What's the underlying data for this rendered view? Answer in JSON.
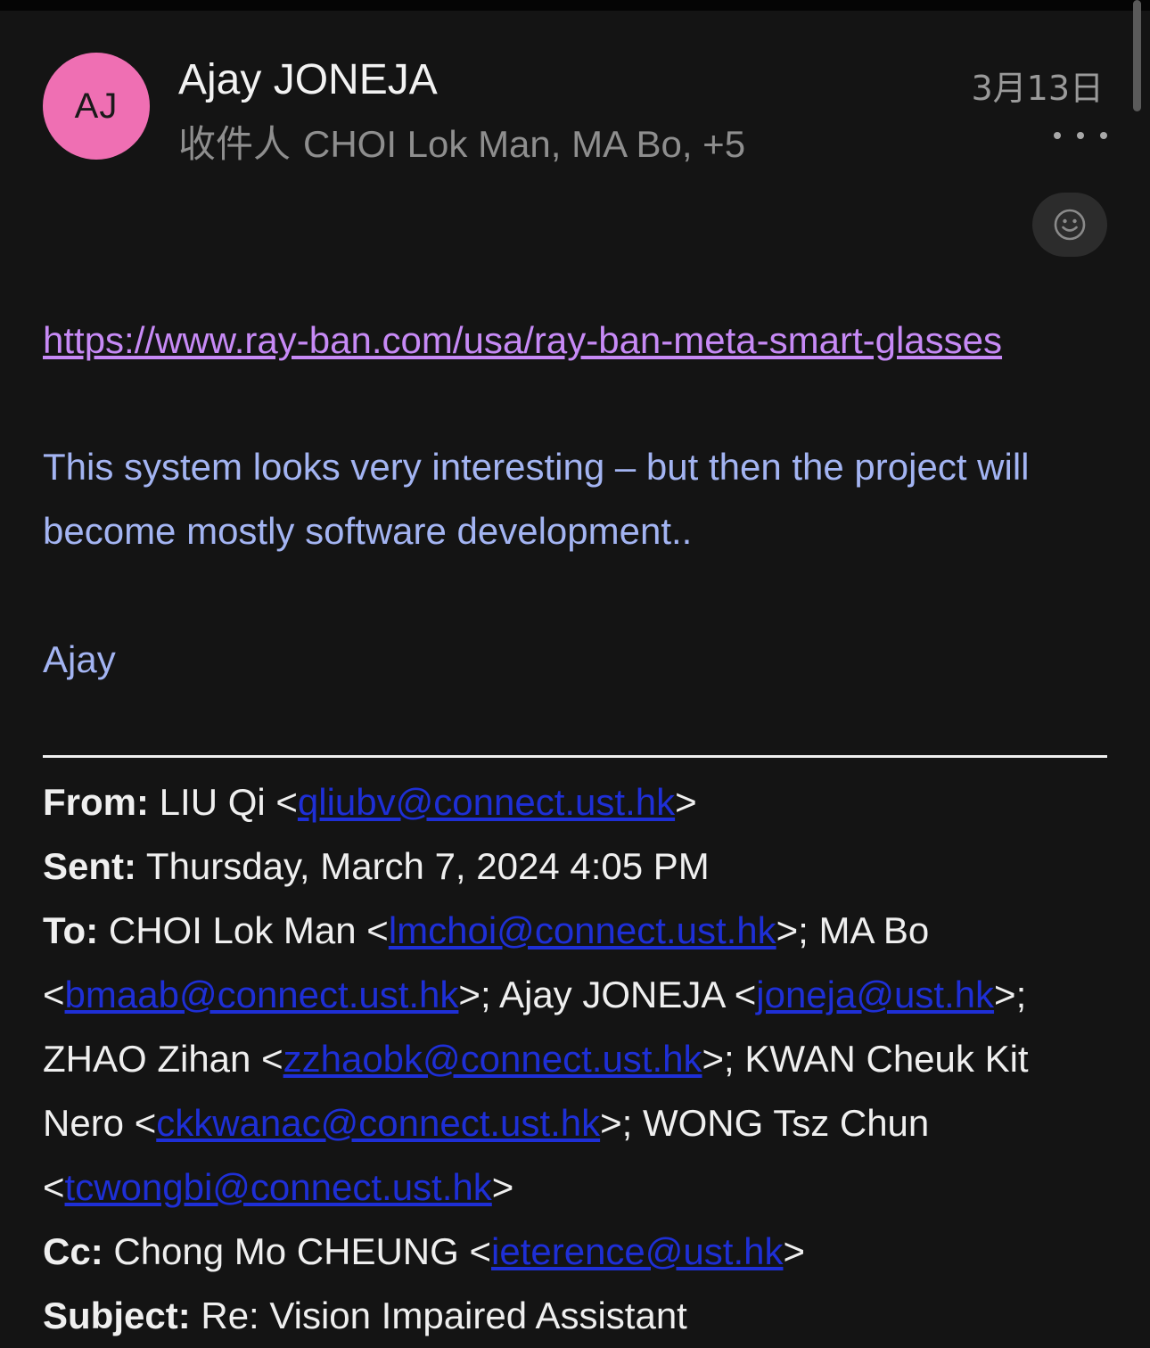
{
  "header": {
    "avatar_initials": "AJ",
    "sender_name": "Ajay JONEJA",
    "to_label": "收件人",
    "recipients_summary": "CHOI Lok Man, MA Bo, +5",
    "date": "3月13日"
  },
  "body": {
    "link_url": "https://www.ray-ban.com/usa/ray-ban-meta-smart-glasses",
    "paragraph": "This system looks very interesting – but then the project will become mostly software development..",
    "signature": "Ajay"
  },
  "quoted": {
    "from": {
      "label": "From:",
      "name": " LIU Qi <",
      "email": "qliubv@connect.ust.hk",
      "tail": ">"
    },
    "sent": {
      "label": "Sent:",
      "value": " Thursday, March 7, 2024 4:05 PM"
    },
    "to": {
      "label": "To:",
      "r1_name": " CHOI Lok Man <",
      "r1_email": "lmchoi@connect.ust.hk",
      "r2_name": ">; MA Bo <",
      "r2_email": "bmaab@connect.ust.hk",
      "r3_name": ">; Ajay JONEJA <",
      "r3_email": "joneja@ust.hk",
      "r4_name": ">; ZHAO Zihan <",
      "r4_email": "zzhaobk@connect.ust.hk",
      "r5_name": ">; KWAN Cheuk Kit Nero <",
      "r5_email": "ckkwanac@connect.ust.hk",
      "r6_name": ">; WONG Tsz Chun <",
      "r6_email": "tcwongbi@connect.ust.hk",
      "tail": ">"
    },
    "cc": {
      "label": "Cc:",
      "name": " Chong Mo CHEUNG <",
      "email": "ieterence@ust.hk",
      "tail": ">"
    },
    "subject": {
      "label": "Subject:",
      "value": " Re: Vision Impaired Assistant"
    }
  },
  "colors": {
    "background": "#141414",
    "avatar": "#ef6fb3",
    "link": "#c78af6",
    "body_text": "#a3b4f2",
    "email_link": "#1e2fd6"
  },
  "icons": {
    "more": "more-horizontal-icon",
    "reaction": "smiley-face-icon"
  }
}
